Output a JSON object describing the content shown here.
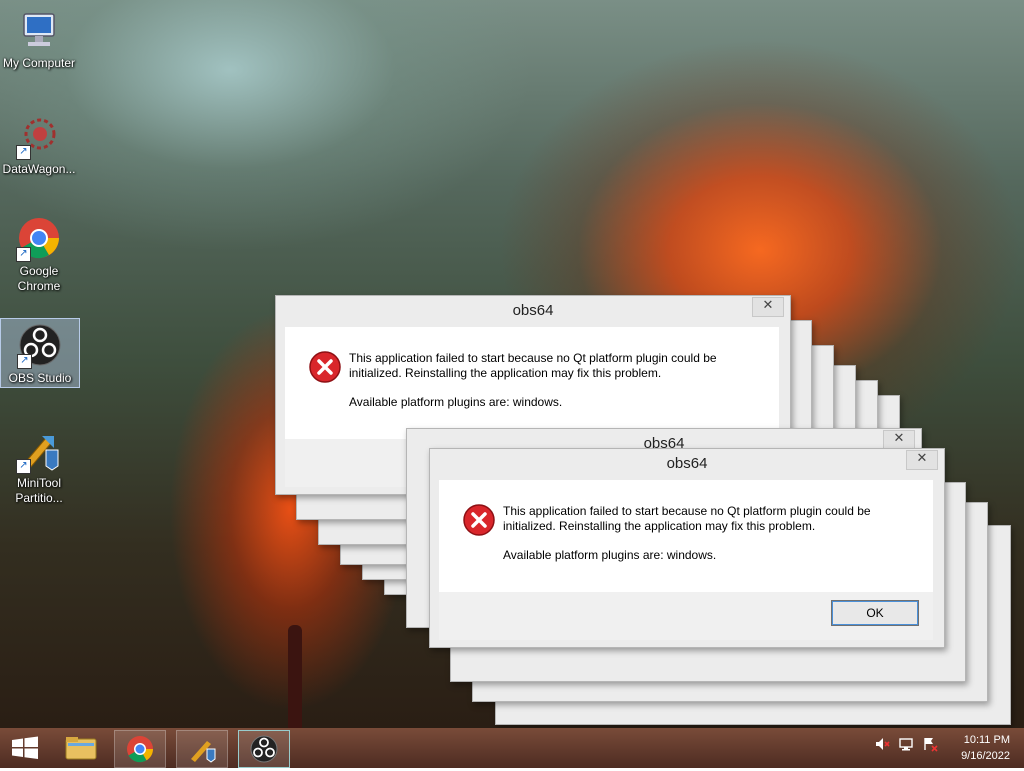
{
  "desktop": {
    "icons": [
      {
        "label": "My Computer"
      },
      {
        "label": "DataWagon..."
      },
      {
        "label_line1": "Google",
        "label_line2": "Chrome"
      },
      {
        "label": "OBS Studio"
      },
      {
        "label_line1": "MiniTool",
        "label_line2": "Partitio..."
      }
    ]
  },
  "dialog": {
    "title": "obs64",
    "close_glyph": "✕",
    "message_line1": "This application failed to start because no Qt platform plugin could be initialized. Reinstalling the application may fix this problem.",
    "message_line2": "Available platform plugins are: windows.",
    "ok_label": "OK",
    "icon": "error-icon"
  },
  "taskbar": {
    "apps": [
      "windows-start-icon",
      "file-explorer-icon",
      "chrome-icon",
      "minitool-icon",
      "obs-icon"
    ],
    "tray": [
      "volume-muted-icon",
      "network-icon",
      "action-center-icon"
    ],
    "time": "10:11 PM",
    "date": "9/16/2022"
  },
  "colors": {
    "error_red": "#d9262b",
    "accent_blue": "#4a90d9"
  }
}
